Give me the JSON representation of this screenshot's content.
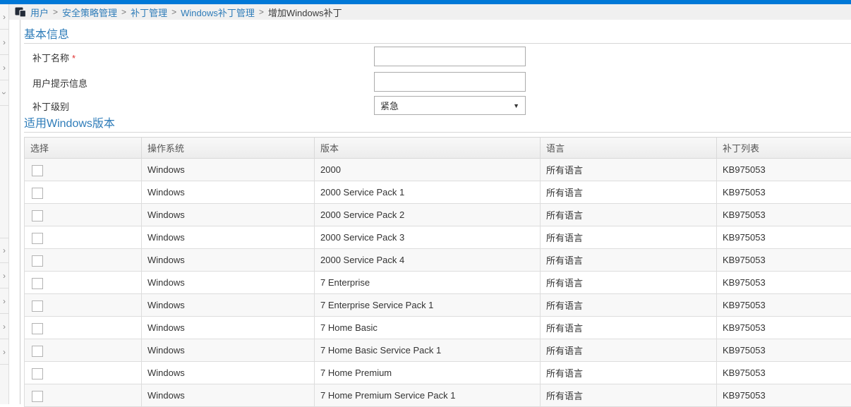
{
  "colors": {
    "topbar": "#0078d7",
    "accent": "#2e7cb9",
    "link": "#2e7cb9"
  },
  "icons": {
    "breadcrumb_icon": "pages-icon",
    "dropdown_arrow": "▼",
    "chevron": "›"
  },
  "breadcrumb": {
    "separator": ">",
    "items": [
      {
        "label": "用户",
        "type": "link"
      },
      {
        "label": "安全策略管理",
        "type": "link"
      },
      {
        "label": "补丁管理",
        "type": "link"
      },
      {
        "label": "Windows补丁管理",
        "type": "link"
      },
      {
        "label": "增加Windows补丁",
        "type": "current"
      }
    ]
  },
  "sidebar": {
    "group1": [
      "right",
      "right",
      "right",
      "down"
    ],
    "group2": [
      "right",
      "right",
      "right",
      "right",
      "right"
    ]
  },
  "sections": {
    "basic_info": "基本信息",
    "windows_versions": "适用Windows版本"
  },
  "form": {
    "patch_name": {
      "label": "补丁名称",
      "required_mark": "*",
      "value": ""
    },
    "user_prompt": {
      "label": "用户提示信息",
      "value": ""
    },
    "patch_level": {
      "label": "补丁级别",
      "value": "紧急"
    }
  },
  "table": {
    "headers": [
      "选择",
      "操作系统",
      "版本",
      "语言",
      "补丁列表"
    ],
    "rows": [
      {
        "checked": false,
        "os": "Windows",
        "version": "2000",
        "language": "所有语言",
        "patches": "KB975053"
      },
      {
        "checked": false,
        "os": "Windows",
        "version": "2000 Service Pack 1",
        "language": "所有语言",
        "patches": "KB975053"
      },
      {
        "checked": false,
        "os": "Windows",
        "version": "2000 Service Pack 2",
        "language": "所有语言",
        "patches": "KB975053"
      },
      {
        "checked": false,
        "os": "Windows",
        "version": "2000 Service Pack 3",
        "language": "所有语言",
        "patches": "KB975053"
      },
      {
        "checked": false,
        "os": "Windows",
        "version": "2000 Service Pack 4",
        "language": "所有语言",
        "patches": "KB975053"
      },
      {
        "checked": false,
        "os": "Windows",
        "version": "7 Enterprise",
        "language": "所有语言",
        "patches": "KB975053"
      },
      {
        "checked": false,
        "os": "Windows",
        "version": "7 Enterprise Service Pack 1",
        "language": "所有语言",
        "patches": "KB975053"
      },
      {
        "checked": false,
        "os": "Windows",
        "version": "7 Home Basic",
        "language": "所有语言",
        "patches": "KB975053"
      },
      {
        "checked": false,
        "os": "Windows",
        "version": "7 Home Basic Service Pack 1",
        "language": "所有语言",
        "patches": "KB975053"
      },
      {
        "checked": false,
        "os": "Windows",
        "version": "7 Home Premium",
        "language": "所有语言",
        "patches": "KB975053"
      },
      {
        "checked": false,
        "os": "Windows",
        "version": "7 Home Premium Service Pack 1",
        "language": "所有语言",
        "patches": "KB975053"
      }
    ]
  }
}
